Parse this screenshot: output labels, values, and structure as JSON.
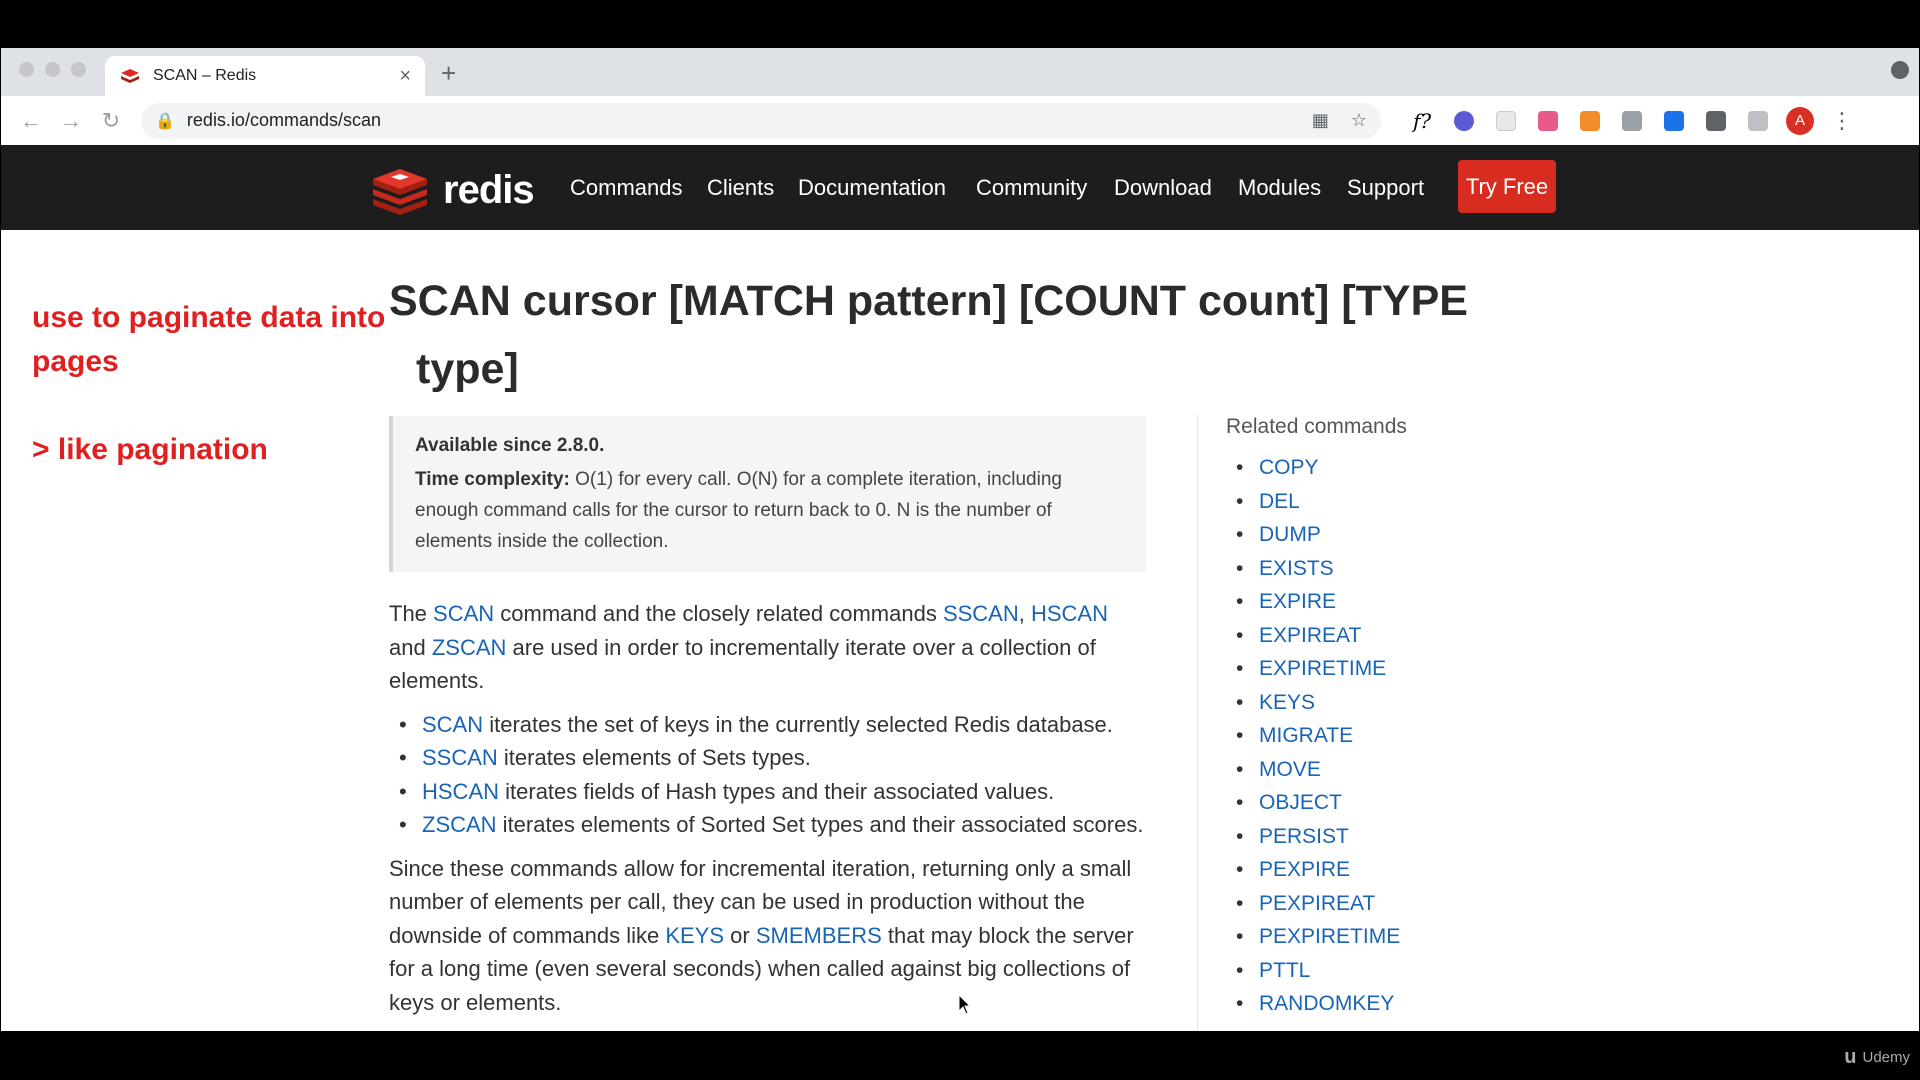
{
  "browser": {
    "tab_title": "SCAN – Redis",
    "tab_close": "×",
    "new_tab": "+",
    "url": "redis.io/commands/scan",
    "avatar_letter": "A"
  },
  "nav": {
    "logo_text": "redis",
    "links": [
      "Commands",
      "Clients",
      "Documentation",
      "Community",
      "Download",
      "Modules",
      "Support"
    ],
    "cta": "Try Free"
  },
  "page": {
    "title_line1": "SCAN cursor [MATCH pattern] [COUNT count] [TYPE",
    "title_line2": "type]",
    "available_since": "Available since 2.8.0.",
    "complexity_label": "Time complexity:",
    "complexity_text": "O(1) for every call. O(N) for a complete iteration, including enough command calls for the cursor to return back to 0. N is the number of elements inside the collection.",
    "intro": {
      "t1": "The ",
      "l1": "SCAN",
      "t2": " command and the closely related commands ",
      "l2": "SSCAN",
      "t3": ", ",
      "l3": "HSCAN",
      "t4": " and ",
      "l4": "ZSCAN",
      "t5": " are used in order to incrementally iterate over a collection of elements."
    },
    "bullets": [
      {
        "link": "SCAN",
        "text": " iterates the set of keys in the currently selected Redis database."
      },
      {
        "link": "SSCAN",
        "text": " iterates elements of Sets types."
      },
      {
        "link": "HSCAN",
        "text": " iterates fields of Hash types and their associated values."
      },
      {
        "link": "ZSCAN",
        "text": " iterates elements of Sorted Set types and their associated scores."
      }
    ],
    "para2": {
      "t1": "Since these commands allow for incremental iteration, returning only a small number of elements per call, they can be used in production without the downside of commands like ",
      "l1": "KEYS",
      "t2": " or ",
      "l2": "SMEMBERS",
      "t3": " that may block the server for a long time (even several seconds) when called against big collections of keys or elements."
    }
  },
  "related": {
    "title": "Related commands",
    "items": [
      "COPY",
      "DEL",
      "DUMP",
      "EXISTS",
      "EXPIRE",
      "EXPIREAT",
      "EXPIRETIME",
      "KEYS",
      "MIGRATE",
      "MOVE",
      "OBJECT",
      "PERSIST",
      "PEXPIRE",
      "PEXPIREAT",
      "PEXPIRETIME",
      "PTTL",
      "RANDOMKEY"
    ]
  },
  "annotation": {
    "line1": "use to paginate data into pages",
    "line2": "> like pagination"
  },
  "watermark": "Udemy",
  "colors": {
    "accent": "#d82c20",
    "link": "#1a64b5",
    "annotation": "#e02020"
  }
}
